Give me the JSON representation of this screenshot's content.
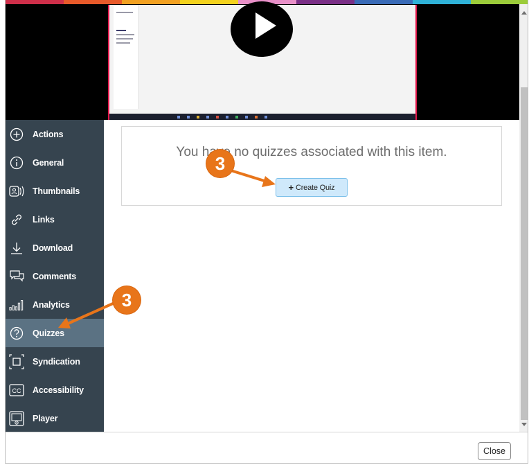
{
  "color_bar": [
    "#cf2f4a",
    "#e85a2a",
    "#f2a122",
    "#f3d21e",
    "#e890c8",
    "#7a2f86",
    "#3a6bb7",
    "#2fb2d8",
    "#9ccc3a"
  ],
  "sidebar": {
    "items": [
      {
        "label": "Actions",
        "icon": "plus-circle-icon"
      },
      {
        "label": "General",
        "icon": "info-circle-icon"
      },
      {
        "label": "Thumbnails",
        "icon": "thumbnails-icon"
      },
      {
        "label": "Links",
        "icon": "link-icon"
      },
      {
        "label": "Download",
        "icon": "download-icon"
      },
      {
        "label": "Comments",
        "icon": "comments-icon"
      },
      {
        "label": "Analytics",
        "icon": "analytics-icon"
      },
      {
        "label": "Quizzes",
        "icon": "question-circle-icon",
        "active": true
      },
      {
        "label": "Syndication",
        "icon": "syndication-icon"
      },
      {
        "label": "Accessibility",
        "icon": "cc-icon"
      },
      {
        "label": "Player",
        "icon": "player-icon"
      }
    ]
  },
  "main": {
    "message": "You have no quizzes associated with this item.",
    "create_button": "Create Quiz",
    "create_button_icon": "plus-icon"
  },
  "footer": {
    "close_label": "Close"
  },
  "annotations": {
    "step_top": "3",
    "step_side": "3",
    "color": "#e8751a"
  }
}
